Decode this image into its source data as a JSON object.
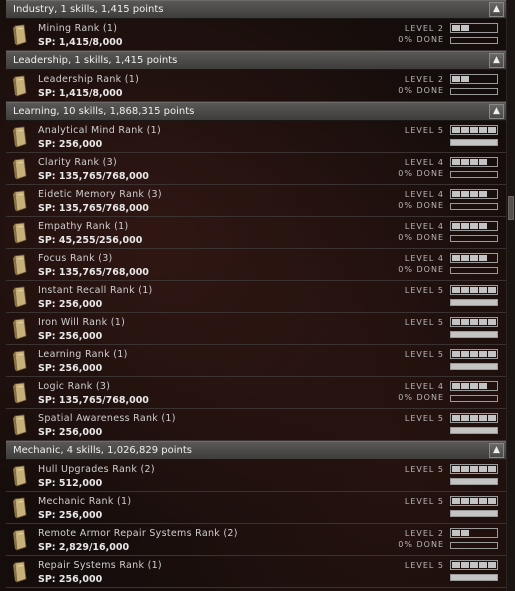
{
  "groups": [
    {
      "title": "Industry, 1 skills, 1,415 points",
      "skills": [
        {
          "name": "Mining Rank (1)",
          "sp": "SP: 1,415/8,000",
          "level_label": "LEVEL 2",
          "done_label": "0% DONE",
          "level": 2,
          "progress": 0.0
        }
      ]
    },
    {
      "title": "Leadership, 1 skills, 1,415 points",
      "skills": [
        {
          "name": "Leadership Rank (1)",
          "sp": "SP: 1,415/8,000",
          "level_label": "LEVEL 2",
          "done_label": "0% DONE",
          "level": 2,
          "progress": 0.0
        }
      ]
    },
    {
      "title": "Learning, 10 skills, 1,868,315 points",
      "skills": [
        {
          "name": "Analytical Mind Rank (1)",
          "sp": "SP: 256,000",
          "level_label": "LEVEL 5",
          "done_label": "",
          "level": 5,
          "progress": 1.0
        },
        {
          "name": "Clarity Rank (3)",
          "sp": "SP: 135,765/768,000",
          "level_label": "LEVEL 4",
          "done_label": "0% DONE",
          "level": 4,
          "progress": 0.0
        },
        {
          "name": "Eidetic Memory Rank (3)",
          "sp": "SP: 135,765/768,000",
          "level_label": "LEVEL 4",
          "done_label": "0% DONE",
          "level": 4,
          "progress": 0.0
        },
        {
          "name": "Empathy Rank (1)",
          "sp": "SP: 45,255/256,000",
          "level_label": "LEVEL 4",
          "done_label": "0% DONE",
          "level": 4,
          "progress": 0.0
        },
        {
          "name": "Focus Rank (3)",
          "sp": "SP: 135,765/768,000",
          "level_label": "LEVEL 4",
          "done_label": "0% DONE",
          "level": 4,
          "progress": 0.0
        },
        {
          "name": "Instant Recall Rank (1)",
          "sp": "SP: 256,000",
          "level_label": "LEVEL 5",
          "done_label": "",
          "level": 5,
          "progress": 1.0
        },
        {
          "name": "Iron Will Rank (1)",
          "sp": "SP: 256,000",
          "level_label": "LEVEL 5",
          "done_label": "",
          "level": 5,
          "progress": 1.0
        },
        {
          "name": "Learning Rank (1)",
          "sp": "SP: 256,000",
          "level_label": "LEVEL 5",
          "done_label": "",
          "level": 5,
          "progress": 1.0
        },
        {
          "name": "Logic Rank (3)",
          "sp": "SP: 135,765/768,000",
          "level_label": "LEVEL 4",
          "done_label": "0% DONE",
          "level": 4,
          "progress": 0.0
        },
        {
          "name": "Spatial Awareness Rank (1)",
          "sp": "SP: 256,000",
          "level_label": "LEVEL 5",
          "done_label": "",
          "level": 5,
          "progress": 1.0
        }
      ]
    },
    {
      "title": "Mechanic, 4 skills, 1,026,829 points",
      "skills": [
        {
          "name": "Hull Upgrades Rank (2)",
          "sp": "SP: 512,000",
          "level_label": "LEVEL 5",
          "done_label": "",
          "level": 5,
          "progress": 1.0
        },
        {
          "name": "Mechanic Rank (1)",
          "sp": "SP: 256,000",
          "level_label": "LEVEL 5",
          "done_label": "",
          "level": 5,
          "progress": 1.0
        },
        {
          "name": "Remote Armor Repair Systems Rank (2)",
          "sp": "SP: 2,829/16,000",
          "level_label": "LEVEL 2",
          "done_label": "0% DONE",
          "level": 2,
          "progress": 0.0
        },
        {
          "name": "Repair Systems Rank (1)",
          "sp": "SP: 256,000",
          "level_label": "LEVEL 5",
          "done_label": "",
          "level": 5,
          "progress": 1.0
        }
      ]
    }
  ],
  "icons": {
    "skill_book": "skill-book-icon",
    "collapse": "chevron-up-icon",
    "collapse_glyph": "▲"
  },
  "colors": {
    "header_bg": "#4a4846",
    "pip_on": "#c4c4c4",
    "background": "#150d0b"
  }
}
